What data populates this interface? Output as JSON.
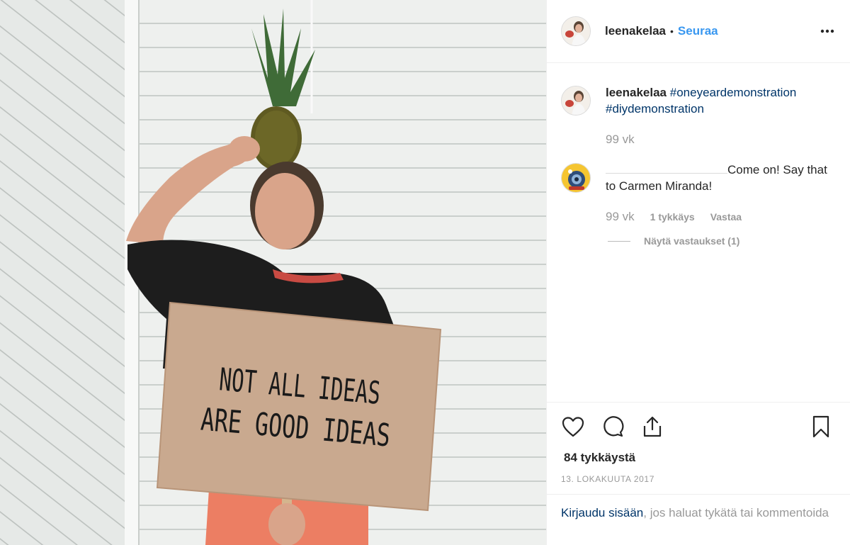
{
  "post": {
    "username": "leenakelaa",
    "follow_label": "Seuraa",
    "separator": "•",
    "photo_sign_line1": "NOT ALL IDEAS",
    "photo_sign_line2": "ARE GOOD IDEAS"
  },
  "comments": [
    {
      "username": "leenakelaa",
      "hashtags": [
        "#oneyeardemonstration",
        "#diydemonstration"
      ],
      "time": "99 vk"
    },
    {
      "text_line1": "Come on! Say that",
      "text_line2": "to Carmen Miranda!",
      "time": "99 vk",
      "likes": "1 tykkäys",
      "reply_label": "Vastaa",
      "view_replies": "Näytä vastaukset (1)"
    }
  ],
  "actions": {
    "likes_count": "84 tykkäystä",
    "date": "13. LOKAKUUTA 2017"
  },
  "login": {
    "link_text": "Kirjaudu sisään",
    "rest_text": ", jos haluat tykätä tai kommentoida"
  },
  "icons": [
    "more-options-icon",
    "heart-icon",
    "comment-icon",
    "share-icon",
    "bookmark-icon"
  ],
  "colors": {
    "link_blue": "#3897f0",
    "hashtag_blue": "#003569",
    "muted_gray": "#999999",
    "text": "#262626"
  }
}
